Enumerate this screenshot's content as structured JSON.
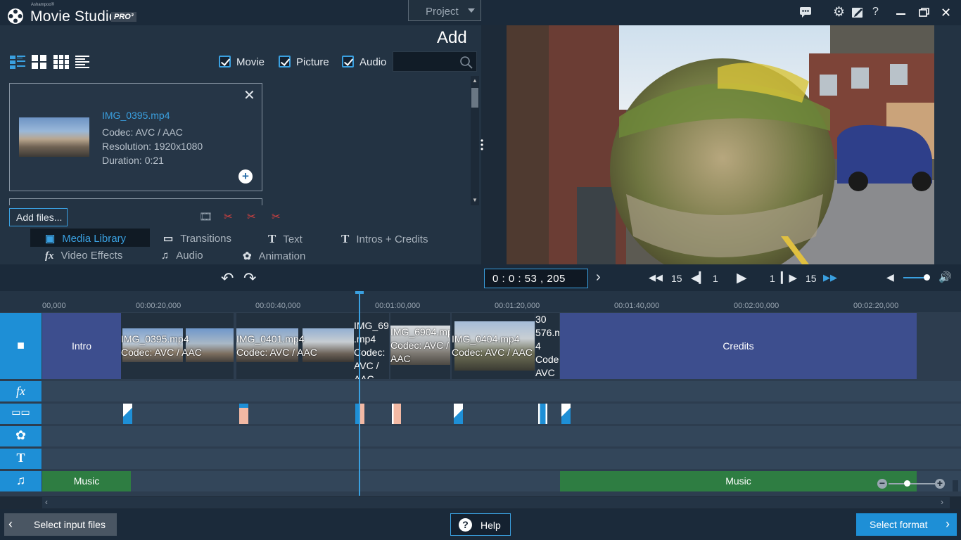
{
  "titlebar": {
    "brand_small": "Ashampoo®",
    "app_title": "Movie Studio",
    "edition": "PRO³",
    "project_menu": "Project",
    "icons": [
      "chat-icon",
      "gear-icon",
      "edit-icon",
      "help-icon",
      "minimize-icon",
      "restore-icon",
      "close-icon"
    ]
  },
  "panel": {
    "title": "Add",
    "filters": [
      {
        "label": "Movie",
        "checked": true
      },
      {
        "label": "Picture",
        "checked": true
      },
      {
        "label": "Audio",
        "checked": true
      }
    ],
    "search_placeholder": ""
  },
  "media_item": {
    "name": "IMG_0395.mp4",
    "codec": "Codec: AVC / AAC",
    "resolution": "Resolution: 1920x1080",
    "duration": "Duration: 0:21"
  },
  "add_files_label": "Add files...",
  "categories": [
    {
      "label": "Media Library",
      "icon": "camera-icon",
      "active": true
    },
    {
      "label": "Transitions",
      "icon": "transitions-icon"
    },
    {
      "label": "Text",
      "icon": "text-icon"
    },
    {
      "label": "Intros + Credits",
      "icon": "text-icon"
    },
    {
      "label": "Video Effects",
      "icon": "fx-icon"
    },
    {
      "label": "Audio",
      "icon": "music-icon"
    },
    {
      "label": "Animation",
      "icon": "flower-icon"
    }
  ],
  "transport": {
    "timecode": "0  :  0  :  53  ,  205",
    "skip_back_label": "15",
    "frame_back_label": "1",
    "frame_fwd_label": "1",
    "skip_fwd_label": "15",
    "volume": 0.85
  },
  "ruler": [
    "00,000",
    "00:00:20,000",
    "00:00:40,000",
    "00:01:00,000",
    "00:01:20,000",
    "00:01:40,000",
    "00:02:00,000",
    "00:02:20,000"
  ],
  "timeline": {
    "intro_label": "Intro",
    "credits_label": "Credits",
    "music_label": "Music",
    "clips": [
      {
        "name": "IMG_0395.mp4",
        "codec": "Codec: AVC / AAC"
      },
      {
        "name": "IMG_0401.mp4",
        "codec": "Codec: AVC / AAC"
      },
      {
        "name_line1": "IMG_6905",
        "name_line2": ".mp4",
        "codec1": "Codec:",
        "codec2": "AVC / AAC"
      },
      {
        "name": "IMG_6904.mp4",
        "codec1": "Codec: AVC /",
        "codec2": "AAC"
      },
      {
        "name": "IMG_0404.mp4",
        "codec": "Codec: AVC / AAC"
      },
      {
        "l1": "30",
        "l2": "576.m",
        "l3": "4",
        "l4": "Codec",
        "l5": "AVC /"
      }
    ]
  },
  "bottom": {
    "back_label": "Select input files",
    "help_label": "Help",
    "next_label": "Select format"
  },
  "colors": {
    "accent": "#1e8fd6",
    "intro_credits": "#3d4e8e",
    "music": "#2e7d42"
  }
}
